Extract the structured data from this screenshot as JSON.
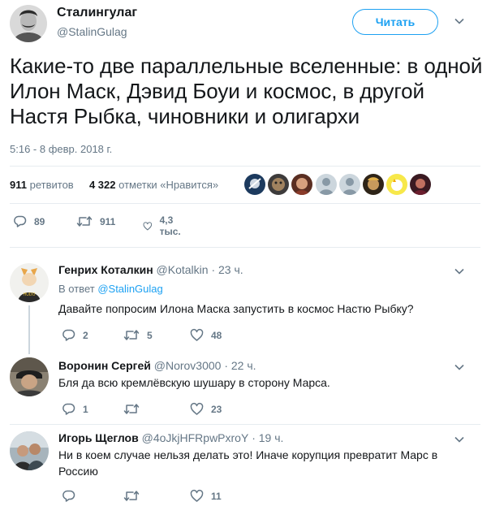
{
  "main_tweet": {
    "author_name": "Сталингулаг",
    "author_handle": "@StalinGulag",
    "follow_label": "Читать",
    "text": "Какие-то две параллельные вселенные: в одной Илон Маск, Дэвид Боуи и космос, в другой Настя Рыбка, чиновники и олигархи",
    "timestamp": "5:16 - 8 февр. 2018 г.",
    "retweet_count": "911",
    "retweet_label": "ретвитов",
    "like_count": "4 322",
    "like_label": "отметки «Нравится»",
    "actions": {
      "replies": "89",
      "retweets": "911",
      "likes": "4,3 тыс."
    }
  },
  "replies": [
    {
      "author_name": "Генрих Коталкин",
      "author_handle": "@Kotalkin",
      "time": "· 23 ч.",
      "reply_prefix": "В ответ",
      "reply_to": "@StalinGulag",
      "text": "Давайте попросим Илона Маска запустить в космос Настю Рыбку?",
      "replies": "2",
      "retweets": "5",
      "likes": "48"
    },
    {
      "author_name": "Воронин Сергей",
      "author_handle": "@Norov3000",
      "time": "· 22 ч.",
      "text": "Бля да всю кремлёвскую шушару в сторону Марса.",
      "replies": "1",
      "retweets": "",
      "likes": "23"
    },
    {
      "author_name": "Игорь Щеглов",
      "author_handle": "@4oJkjHFRpwPxroY",
      "time": "· 19 ч.",
      "text_line1": "Ни в коем случае нельзя делать это! Иначе корупция превратит Марс в",
      "text_line2": "Россию",
      "replies": "",
      "retweets": "",
      "likes": "11"
    }
  ],
  "colors": {
    "accent": "#1da1f2",
    "secondary_text": "#657786",
    "divider": "#e6ecf0"
  },
  "icons": {
    "reply": "reply-icon",
    "retweet": "retweet-icon",
    "like": "heart-icon",
    "more": "chevron-down-icon"
  }
}
